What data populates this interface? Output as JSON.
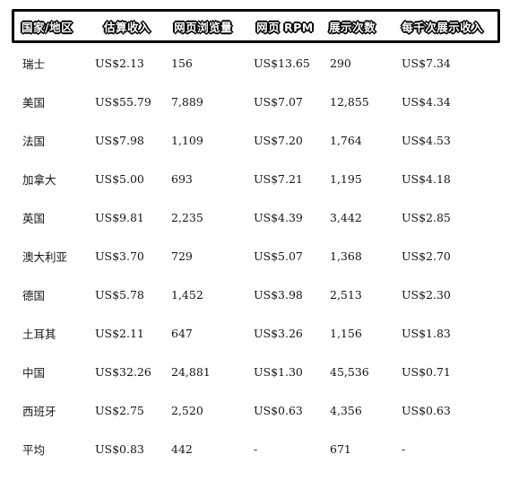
{
  "table": {
    "headers": [
      "国家/地区",
      "估算收入",
      "网页浏览量",
      "网页 RPM",
      "展示次数",
      "每千次展示收入"
    ],
    "rows": [
      [
        "瑞士",
        "US$2.13",
        "156",
        "US$13.65",
        "290",
        "US$7.34"
      ],
      [
        "美国",
        "US$55.79",
        "7,889",
        "US$7.07",
        "12,855",
        "US$4.34"
      ],
      [
        "法国",
        "US$7.98",
        "1,109",
        "US$7.20",
        "1,764",
        "US$4.53"
      ],
      [
        "加拿大",
        "US$5.00",
        "693",
        "US$7.21",
        "1,195",
        "US$4.18"
      ],
      [
        "英国",
        "US$9.81",
        "2,235",
        "US$4.39",
        "3,442",
        "US$2.85"
      ],
      [
        "澳大利亚",
        "US$3.70",
        "729",
        "US$5.07",
        "1,368",
        "US$2.70"
      ],
      [
        "德国",
        "US$5.78",
        "1,452",
        "US$3.98",
        "2,513",
        "US$2.30"
      ],
      [
        "土耳其",
        "US$2.11",
        "647",
        "US$3.26",
        "1,156",
        "US$1.83"
      ],
      [
        "中国",
        "US$32.26",
        "24,881",
        "US$1.30",
        "45,536",
        "US$0.71"
      ],
      [
        "西班牙",
        "US$2.75",
        "2,520",
        "US$0.63",
        "4,356",
        "US$0.63"
      ],
      [
        "平均",
        "US$0.83",
        "442",
        "-",
        "671",
        "-"
      ]
    ]
  }
}
